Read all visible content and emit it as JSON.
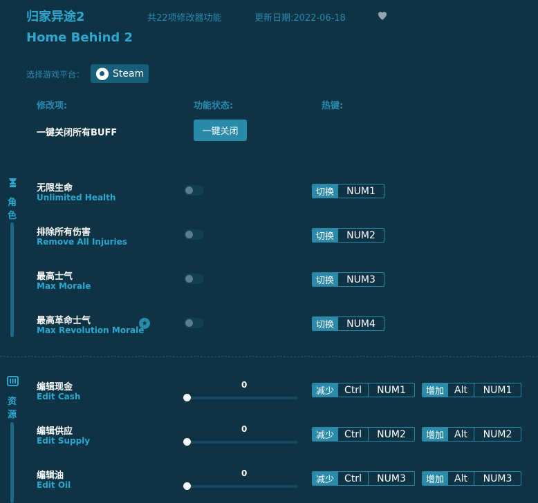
{
  "header": {
    "title_cn": "归家异途2",
    "feature_count": "共22项修改器功能",
    "update_date": "更新日期:2022-06-18",
    "title_en": "Home Behind 2"
  },
  "platform": {
    "label": "选择游戏平台：",
    "steam_label": "Steam"
  },
  "columns": {
    "mod": "修改项:",
    "status": "功能状态:",
    "hotkey": "热键:"
  },
  "buff": {
    "label": "一键关闭所有BUFF",
    "button": "一键关闭"
  },
  "sections": {
    "character": {
      "chars": [
        "角",
        "色"
      ],
      "icon": "character-icon"
    },
    "resources": {
      "chars": [
        "资",
        "源"
      ],
      "icon": "resources-icon"
    }
  },
  "toggle_items": [
    {
      "cn": "无限生命",
      "en": "Unlimited Health",
      "tag": "切换",
      "key": "NUM1",
      "starred": false
    },
    {
      "cn": "排除所有伤害",
      "en": "Remove All Injuries",
      "tag": "切换",
      "key": "NUM2",
      "starred": false
    },
    {
      "cn": "最高士气",
      "en": "Max Morale",
      "tag": "切换",
      "key": "NUM3",
      "starred": false
    },
    {
      "cn": "最高革命士气",
      "en": "Max Revolution Morale",
      "tag": "切换",
      "key": "NUM4",
      "starred": true
    }
  ],
  "slider_items": [
    {
      "cn": "编辑现金",
      "en": "Edit Cash",
      "value": "0",
      "dec": {
        "tag": "减少",
        "mod": "Ctrl",
        "key": "NUM1"
      },
      "inc": {
        "tag": "增加",
        "mod": "Alt",
        "key": "NUM1"
      }
    },
    {
      "cn": "编辑供应",
      "en": "Edit Supply",
      "value": "0",
      "dec": {
        "tag": "减少",
        "mod": "Ctrl",
        "key": "NUM2"
      },
      "inc": {
        "tag": "增加",
        "mod": "Alt",
        "key": "NUM2"
      }
    },
    {
      "cn": "编辑油",
      "en": "Edit Oil",
      "value": "0",
      "dec": {
        "tag": "减少",
        "mod": "Ctrl",
        "key": "NUM3"
      },
      "inc": {
        "tag": "增加",
        "mod": "Alt",
        "key": "NUM3"
      }
    }
  ],
  "colors": {
    "background": "#0d3344",
    "accent": "#2ca7d0",
    "button": "#2a8aaa"
  }
}
